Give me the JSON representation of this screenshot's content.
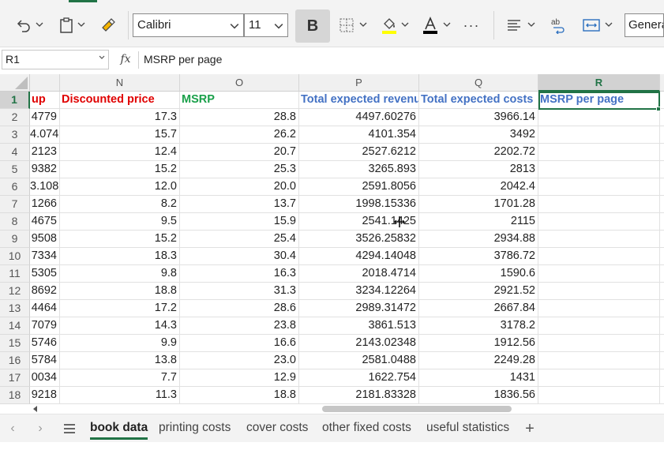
{
  "toolbar": {
    "font_name": "Calibri",
    "font_size": "11",
    "bold_label": "B",
    "number_format": "General",
    "more_label": "···",
    "icons": [
      "undo-icon",
      "paste-icon",
      "format-painter-icon",
      "borders-icon",
      "fill-color-icon",
      "font-color-icon",
      "more-icon",
      "align-icon",
      "wrap-text-icon",
      "merge-icon"
    ],
    "fill_color": "#ffff00",
    "font_color": "#000000",
    "accent": "#217346"
  },
  "formula_bar": {
    "name_box": "R1",
    "fx_label": "fx",
    "formula": "MSRP per page"
  },
  "grid": {
    "columns": [
      {
        "letter": "",
        "selected": false
      },
      {
        "letter": "N",
        "selected": false
      },
      {
        "letter": "O",
        "selected": false
      },
      {
        "letter": "P",
        "selected": false
      },
      {
        "letter": "Q",
        "selected": false
      },
      {
        "letter": "R",
        "selected": true
      }
    ],
    "header_row": {
      "row": "1",
      "cells": [
        "up",
        "Discounted price",
        "MSRP",
        "Total expected revenue",
        "Total expected costs",
        "MSRP per page"
      ]
    },
    "rows": [
      {
        "row": "2",
        "cells": [
          "4779",
          "17.3",
          "28.8",
          "4497.60276",
          "3966.14",
          ""
        ]
      },
      {
        "row": "3",
        "cells": [
          "4.074",
          "15.7",
          "26.2",
          "4101.354",
          "3492",
          ""
        ]
      },
      {
        "row": "4",
        "cells": [
          "2123",
          "12.4",
          "20.7",
          "2527.6212",
          "2202.72",
          ""
        ]
      },
      {
        "row": "5",
        "cells": [
          "9382",
          "15.2",
          "25.3",
          "3265.893",
          "2813",
          ""
        ]
      },
      {
        "row": "6",
        "cells": [
          "3.108",
          "12.0",
          "20.0",
          "2591.8056",
          "2042.4",
          ""
        ]
      },
      {
        "row": "7",
        "cells": [
          "1266",
          "8.2",
          "13.7",
          "1998.15336",
          "1701.28",
          ""
        ]
      },
      {
        "row": "8",
        "cells": [
          "4675",
          "9.5",
          "15.9",
          "2541.1425",
          "2115",
          ""
        ]
      },
      {
        "row": "9",
        "cells": [
          "9508",
          "15.2",
          "25.4",
          "3526.25832",
          "2934.88",
          ""
        ]
      },
      {
        "row": "10",
        "cells": [
          "7334",
          "18.3",
          "30.4",
          "4294.14048",
          "3786.72",
          ""
        ]
      },
      {
        "row": "11",
        "cells": [
          "5305",
          "9.8",
          "16.3",
          "2018.4714",
          "1590.6",
          ""
        ]
      },
      {
        "row": "12",
        "cells": [
          "8692",
          "18.8",
          "31.3",
          "3234.12264",
          "2921.52",
          ""
        ]
      },
      {
        "row": "13",
        "cells": [
          "4464",
          "17.2",
          "28.6",
          "2989.31472",
          "2667.84",
          ""
        ]
      },
      {
        "row": "14",
        "cells": [
          "7079",
          "14.3",
          "23.8",
          "3861.513",
          "3178.2",
          ""
        ]
      },
      {
        "row": "15",
        "cells": [
          "5746",
          "9.9",
          "16.6",
          "2143.02348",
          "1912.56",
          ""
        ]
      },
      {
        "row": "16",
        "cells": [
          "5784",
          "13.8",
          "23.0",
          "2581.0488",
          "2249.28",
          ""
        ]
      },
      {
        "row": "17",
        "cells": [
          "0034",
          "7.7",
          "12.9",
          "1622.754",
          "1431",
          ""
        ]
      },
      {
        "row": "18",
        "cells": [
          "9218",
          "11.3",
          "18.8",
          "2181.83328",
          "1836.56",
          ""
        ]
      }
    ],
    "header_colors": {
      "red": "#e00000",
      "green": "#1aa04a",
      "blue": "#4472c4"
    }
  },
  "sheet_tabs": {
    "tabs": [
      {
        "label": "book data",
        "active": true
      },
      {
        "label": "printing costs",
        "active": false
      },
      {
        "label": "cover costs",
        "active": false
      },
      {
        "label": "other fixed costs",
        "active": false
      },
      {
        "label": "useful statistics",
        "active": false
      }
    ],
    "add_label": "+",
    "prev_label": "‹",
    "next_label": "›"
  }
}
